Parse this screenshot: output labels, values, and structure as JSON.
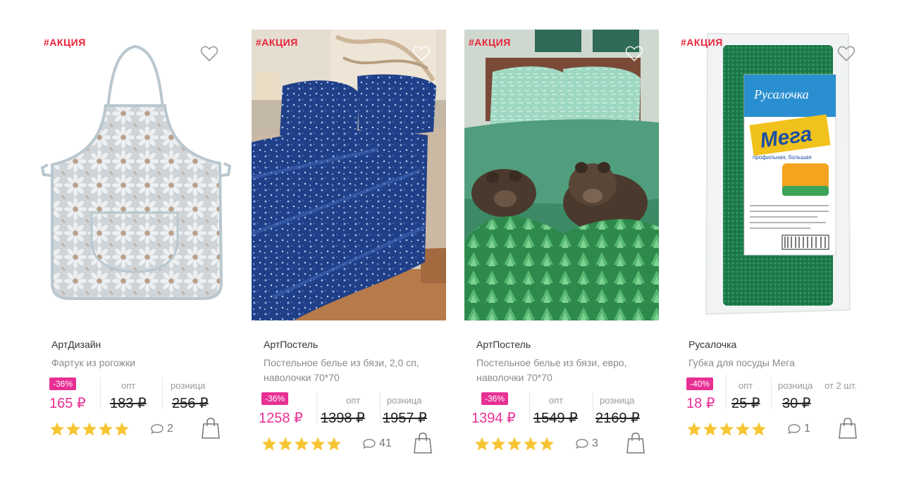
{
  "colors": {
    "promo": "#e8253a",
    "accent": "#e82f93",
    "star": "#f7c532"
  },
  "products": [
    {
      "promo": "#АКЦИЯ",
      "brand": "АртДизайн",
      "name": "Фартук из рогожки",
      "discount": "-36%",
      "price": "165 ₽",
      "opt_label": "опт",
      "opt_price": "183 ₽",
      "retail_label": "розница",
      "retail_price": "256 ₽",
      "bulk_note": "",
      "rating": 5,
      "comments": "2",
      "icons": {
        "favorite": "heart-icon",
        "comments": "comment-icon",
        "cart": "shopping-bag-icon"
      }
    },
    {
      "promo": "#АКЦИЯ",
      "brand": "АртПостель",
      "name": "Постельное белье из бязи, 2,0 сп, наволочки 70*70",
      "discount": "-36%",
      "price": "1258 ₽",
      "opt_label": "опт",
      "opt_price": "1398 ₽",
      "retail_label": "розница",
      "retail_price": "1957 ₽",
      "bulk_note": "",
      "rating": 5,
      "comments": "41",
      "icons": {
        "favorite": "heart-icon",
        "comments": "comment-icon",
        "cart": "shopping-bag-icon"
      }
    },
    {
      "promo": "#АКЦИЯ",
      "brand": "АртПостель",
      "name": "Постельное белье из бязи, евро, наволочки 70*70",
      "discount": "-36%",
      "price": "1394 ₽",
      "opt_label": "опт",
      "opt_price": "1549 ₽",
      "retail_label": "розница",
      "retail_price": "2169 ₽",
      "bulk_note": "",
      "rating": 5,
      "comments": "3",
      "icons": {
        "favorite": "heart-icon",
        "comments": "comment-icon",
        "cart": "shopping-bag-icon"
      }
    },
    {
      "promo": "#АКЦИЯ",
      "brand": "Русалочка",
      "name": "Губка для посуды Мега",
      "discount": "-40%",
      "price": "18 ₽",
      "opt_label": "опт",
      "opt_price": "25 ₽",
      "retail_label": "розница",
      "retail_price": "30 ₽",
      "bulk_note": "от 2 шт.",
      "rating": 5,
      "comments": "1",
      "package_brand": "Русалочка",
      "package_title": "Мега",
      "package_sub": "профильная, большая",
      "icons": {
        "favorite": "heart-icon",
        "comments": "comment-icon",
        "cart": "shopping-bag-icon"
      }
    }
  ]
}
